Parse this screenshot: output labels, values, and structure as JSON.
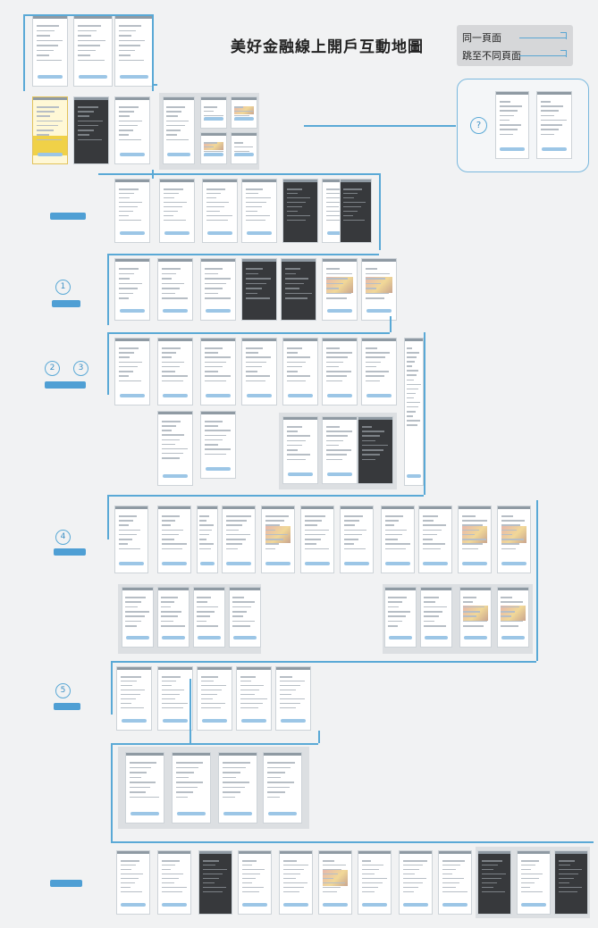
{
  "title": "美好金融線上開戶互動地圖",
  "legend": {
    "same_page": "同一頁面",
    "different_page": "跳至不同頁面"
  },
  "help_marker": "?",
  "steps": [
    "1",
    "2",
    "3",
    "4",
    "5"
  ],
  "colors": {
    "accent": "#5aa9d6",
    "button": "#9cc6e6",
    "tag": "#4f9fd4",
    "group_background": "#dcdfe2",
    "dark_screen": "#37393c",
    "highlight_screen": "#fff8d6"
  }
}
